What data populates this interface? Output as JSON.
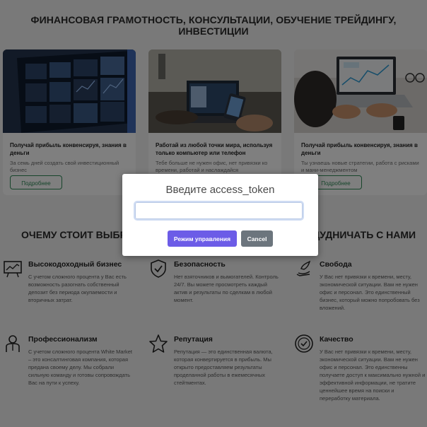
{
  "header": {
    "headline": "ФИНАНСОВАЯ ГРАМОТНОСТЬ, КОНСУЛЬТАЦИИ, ОБУЧЕНИЕ ТРЕЙДИНГУ, ИНВЕСТИЦИИ"
  },
  "cards": [
    {
      "image": "trading-dashboard-photo",
      "title": "Получай прибыль конвенсируя, знания в деньги",
      "desc": "За семь дней создать свой инвестиционный бизнес",
      "button": "Подробнее"
    },
    {
      "image": "remote-work-laptop-photo",
      "title": "Работай из любой точки мира, используя только компьютер или телефон",
      "desc": "Тебе больше не нужен офис, нет привязки ко времени, работай и наслаждайся",
      "button": "Подробнее"
    },
    {
      "image": "laptop-charts-photo",
      "title": "Получай прибыль конвенсируя, знания в деньги",
      "desc": "Ты узнаешь новые стратегии, работа с рисками и мани-менеджментом",
      "button": "Подробнее"
    }
  ],
  "section": {
    "left_text": "ОЧЕМУ СТОИТ ВЫБРА",
    "right_text": "ЩУДНИЧАТЬ С НАМИ"
  },
  "features": [
    {
      "icon": "chart-board-icon",
      "title": "Высокодоходный бизнес",
      "desc": "С учетом сложного процента у Вас есть возможность разогнать собственный депозит без периода окупаемости и вторичных затрат."
    },
    {
      "icon": "shield-check-icon",
      "title": "Безопасность",
      "desc": "Нет взяточников и вымогателей. Контроль 24/7. Вы можете просмотреть каждый актив и результаты по сделкам в любой момент."
    },
    {
      "icon": "bird-hand-icon",
      "title": "Свобода",
      "desc": "У Вас нет привязки к времени, месту, экономической ситуации. Вам не нужен офис и персонал. Это единственный бизнес, который можно попробовать без вложений."
    },
    {
      "icon": "professional-person-icon",
      "title": "Профессионализм",
      "desc": "С учетом сложного процента White Market – это консалтинговая компания, которая предана своему делу. Мы собрали сильную команду и готовы сопровождать Вас на пути к успеху."
    },
    {
      "icon": "star-icon",
      "title": "Репутация",
      "desc": "Репутация — это единственная валюта, которая конвертируется в прибыль. Мы открыто предоставляем результаты проделанной работы в ежемесячных стейтментах."
    },
    {
      "icon": "quality-badge-icon",
      "title": "Качество",
      "desc": "У Вас нет привязки к времени, месту, экономической ситуации. Вам не нужен офис и персонал. Это единственны получаете доступ к максимально нужной и эффективной информации, не тратите ценнейшее время на поиски и переработку материала."
    }
  ],
  "modal": {
    "title": "Введите access_token",
    "input_value": "",
    "input_placeholder": "",
    "primary_button": "Режим управления",
    "cancel_button": "Cancel",
    "primary_color": "#6c5ce7",
    "cancel_color": "#6c757d"
  },
  "colors": {
    "accent_green": "#2e8b57",
    "overlay": "rgba(0,0,0,0.5)"
  }
}
